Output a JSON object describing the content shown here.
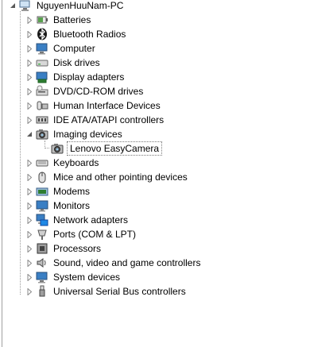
{
  "tree": {
    "root": {
      "label": "NguyenHuuNam-PC",
      "icon": "computer-icon"
    },
    "items": [
      {
        "label": "Batteries",
        "icon": "battery-icon",
        "expanded": false
      },
      {
        "label": "Bluetooth Radios",
        "icon": "bluetooth-icon",
        "expanded": false
      },
      {
        "label": "Computer",
        "icon": "computer-icon",
        "expanded": false
      },
      {
        "label": "Disk drives",
        "icon": "disk-drive-icon",
        "expanded": false
      },
      {
        "label": "Display adapters",
        "icon": "display-adapter-icon",
        "expanded": false
      },
      {
        "label": "DVD/CD-ROM drives",
        "icon": "dvd-drive-icon",
        "expanded": false
      },
      {
        "label": "Human Interface Devices",
        "icon": "hid-icon",
        "expanded": false
      },
      {
        "label": "IDE ATA/ATAPI controllers",
        "icon": "ide-controller-icon",
        "expanded": false
      },
      {
        "label": "Imaging devices",
        "icon": "camera-icon",
        "expanded": true,
        "children": [
          {
            "label": "Lenovo EasyCamera",
            "icon": "camera-icon",
            "selected": true
          }
        ]
      },
      {
        "label": "Keyboards",
        "icon": "keyboard-icon",
        "expanded": false
      },
      {
        "label": "Mice and other pointing devices",
        "icon": "mouse-icon",
        "expanded": false
      },
      {
        "label": "Modems",
        "icon": "modem-icon",
        "expanded": false
      },
      {
        "label": "Monitors",
        "icon": "monitor-icon",
        "expanded": false
      },
      {
        "label": "Network adapters",
        "icon": "network-adapter-icon",
        "expanded": false
      },
      {
        "label": "Ports (COM & LPT)",
        "icon": "port-icon",
        "expanded": false
      },
      {
        "label": "Processors",
        "icon": "processor-icon",
        "expanded": false
      },
      {
        "label": "Sound, video and game controllers",
        "icon": "sound-icon",
        "expanded": false
      },
      {
        "label": "System devices",
        "icon": "system-device-icon",
        "expanded": false
      },
      {
        "label": "Universal Serial Bus controllers",
        "icon": "usb-icon",
        "expanded": false
      }
    ]
  }
}
